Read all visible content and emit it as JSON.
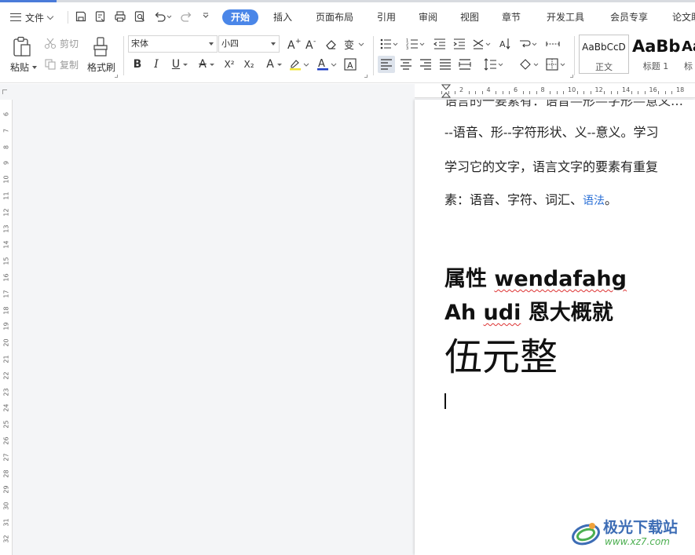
{
  "menu": {
    "file_label": "文件"
  },
  "tabs": [
    {
      "label": "开始",
      "active": true
    },
    {
      "label": "插入"
    },
    {
      "label": "页面布局"
    },
    {
      "label": "引用"
    },
    {
      "label": "审阅"
    },
    {
      "label": "视图"
    },
    {
      "label": "章节"
    },
    {
      "label": "开发工具"
    },
    {
      "label": "会员专享"
    },
    {
      "label": "论文助"
    }
  ],
  "quick_access_icons": [
    "save-icon",
    "export-pdf-icon",
    "print-icon",
    "print-preview-icon",
    "undo-icon",
    "redo-icon",
    "customize-icon"
  ],
  "ribbon": {
    "paste_label": "粘贴",
    "cut_label": "剪切",
    "copy_label": "复制",
    "format_painter_label": "格式刷",
    "font_name": "宋体",
    "font_size": "小四",
    "bold": "B",
    "italic": "I",
    "underline": "U",
    "strikethrough": "A",
    "superscript": "X²",
    "subscript": "X₂",
    "text_effect": "A",
    "font_color_glyph": "A",
    "char_border_glyph": "A",
    "styles": [
      {
        "sample": "AaBbCcD",
        "label": "正文"
      },
      {
        "sample": "AaBb",
        "label": "标题 1"
      },
      {
        "sample": "Aa",
        "label": "标"
      }
    ]
  },
  "ruler": {
    "h_numbers": [
      "2",
      "4",
      "6",
      "8",
      "10",
      "12",
      "14",
      "16",
      "18"
    ],
    "v_numbers": [
      "6",
      "7",
      "8",
      "9",
      "10",
      "11",
      "12",
      "13",
      "14",
      "15",
      "16",
      "17",
      "18",
      "19",
      "20",
      "21",
      "22",
      "23",
      "24",
      "25",
      "26",
      "27",
      "28",
      "29",
      "30",
      "31",
      "32"
    ]
  },
  "document": {
    "line_top_partial": "语言的一要素有：语音—形—字形—意义…",
    "line1": "--语音、形--字符形状、义--意义。学习",
    "line2": "学习它的文字，语言文字的要素有重复",
    "line3_prefix": "素：语音、字符、词汇、",
    "line3_link": "语法",
    "line3_suffix": "。",
    "heading1_cn": "属性 ",
    "heading1_en": "wendafahg",
    "heading2_en1": "Ah ",
    "heading2_en2": "udi",
    "heading2_cn": " 恩大概就",
    "big_text": "伍元整"
  },
  "watermark": {
    "title": "极光下载站",
    "url": "www.xz7.com"
  },
  "colors": {
    "accent": "#4a86e8",
    "link": "#2a6fd6",
    "watermark_blue": "#3d6db5",
    "watermark_green": "#4caf50"
  }
}
